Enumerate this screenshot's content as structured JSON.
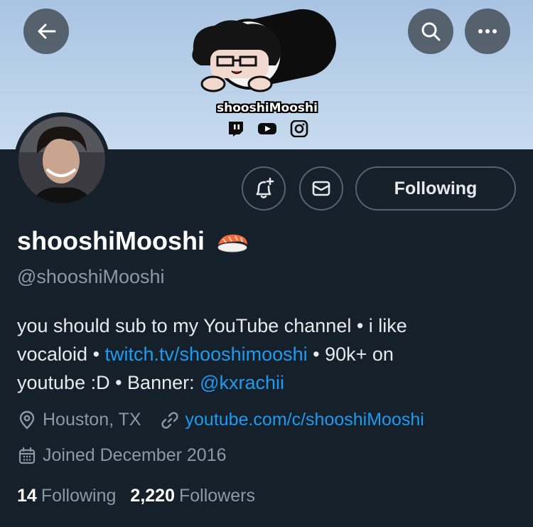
{
  "banner": {
    "name_text": "shooshiMooshi",
    "socials": [
      "twitch-icon",
      "youtube-icon",
      "instagram-icon"
    ]
  },
  "nav": {
    "back_icon": "arrow-left-icon",
    "search_icon": "search-icon",
    "more_icon": "more-dots-icon"
  },
  "actions": {
    "notify_icon": "bell-plus-icon",
    "message_icon": "envelope-icon",
    "following_label": "Following"
  },
  "profile": {
    "display_name": "shooshiMooshi",
    "handle": "@shooshiMooshi",
    "bio": {
      "line1": "you should sub to my YouTube channel • i like",
      "line2_pre": "vocaloid • ",
      "line2_link": "twitch.tv/shooshimooshi",
      "line2_post": " • 90k+ on",
      "line3_pre": "youtube :D • Banner: ",
      "line3_link": "@kxrachii"
    },
    "location": "Houston, TX",
    "website": "youtube.com/c/shooshiMooshi",
    "joined": "Joined December 2016",
    "following_count": "14",
    "following_label": "Following",
    "followers_count": "2,220",
    "followers_label": "Followers"
  },
  "colors": {
    "background": "#15202b",
    "accent": "#1d9bf0",
    "muted": "#8b98a5",
    "banner": "#b8d0ea"
  }
}
